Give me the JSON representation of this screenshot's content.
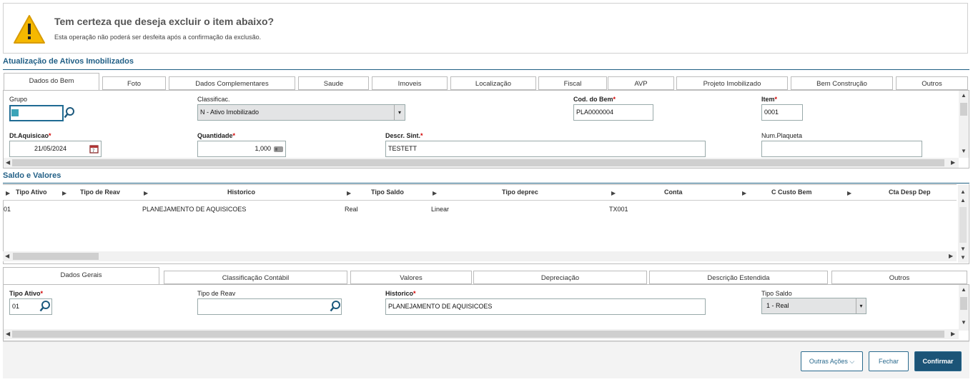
{
  "dialog": {
    "title": "Tem certeza que deseja excluir o item abaixo?",
    "subtitle": "Esta operação não poderá ser desfeita após a confirmação da exclusão."
  },
  "section1": {
    "title": "Atualização de Ativos Imobilizados",
    "tabs": [
      "Dados do Bem",
      "Foto",
      "Dados Complementares",
      "Saude",
      "Imoveis",
      "Localização",
      "Fiscal",
      "AVP",
      "Projeto Imobilizado",
      "Bem Construção",
      "Outros"
    ],
    "fields": {
      "grupo_label": "Grupo",
      "grupo_value": "",
      "classificac_label": "Classificac.",
      "classificac_value": "N - Ativo Imobilizado",
      "cod_bem_label": "Cod. do Bem",
      "cod_bem_value": "PLA0000004",
      "item_label": "Item",
      "item_value": "0001",
      "dt_aquisicao_label": "Dt.Aquisicao",
      "dt_aquisicao_value": "21/05/2024",
      "quantidade_label": "Quantidade",
      "quantidade_value": "1,000",
      "descr_sint_label": "Descr. Sint.",
      "descr_sint_value": "TESTETT",
      "num_plaqueta_label": "Num.Plaqueta",
      "num_plaqueta_value": ""
    }
  },
  "section2": {
    "title": "Saldo e Valores",
    "columns": [
      "Tipo Ativo",
      "Tipo de Reav",
      "Historico",
      "Tipo Saldo",
      "Tipo deprec",
      "Conta",
      "C Custo Bem",
      "Cta Desp Dep"
    ],
    "rows": [
      {
        "tipo_ativo": "01",
        "tipo_reav": "",
        "historico": "PLANEJAMENTO DE AQUISICOES",
        "tipo_saldo": "Real",
        "tipo_deprec": "Linear",
        "conta": "TX001"
      }
    ]
  },
  "section3": {
    "tabs": [
      "Dados Gerais",
      "Classificação Contábil",
      "Valores",
      "Depreciação",
      "Descrição Estendida",
      "Outros"
    ],
    "fields": {
      "tipo_ativo_label": "Tipo Ativo",
      "tipo_ativo_value": "01",
      "tipo_reav_label": "Tipo de Reav",
      "tipo_reav_value": "",
      "historico_label": "Historico",
      "historico_value": "PLANEJAMENTO DE AQUISICOES",
      "tipo_saldo_label": "Tipo Saldo",
      "tipo_saldo_value": "1 - Real"
    }
  },
  "buttons": {
    "outras_acoes": "Outras Ações",
    "fechar": "Fechar",
    "confirmar": "Confirmar"
  },
  "colors": {
    "accent": "#1c5477",
    "section_title": "#215f86",
    "required": "#d20000",
    "warning": "#f5b800"
  }
}
